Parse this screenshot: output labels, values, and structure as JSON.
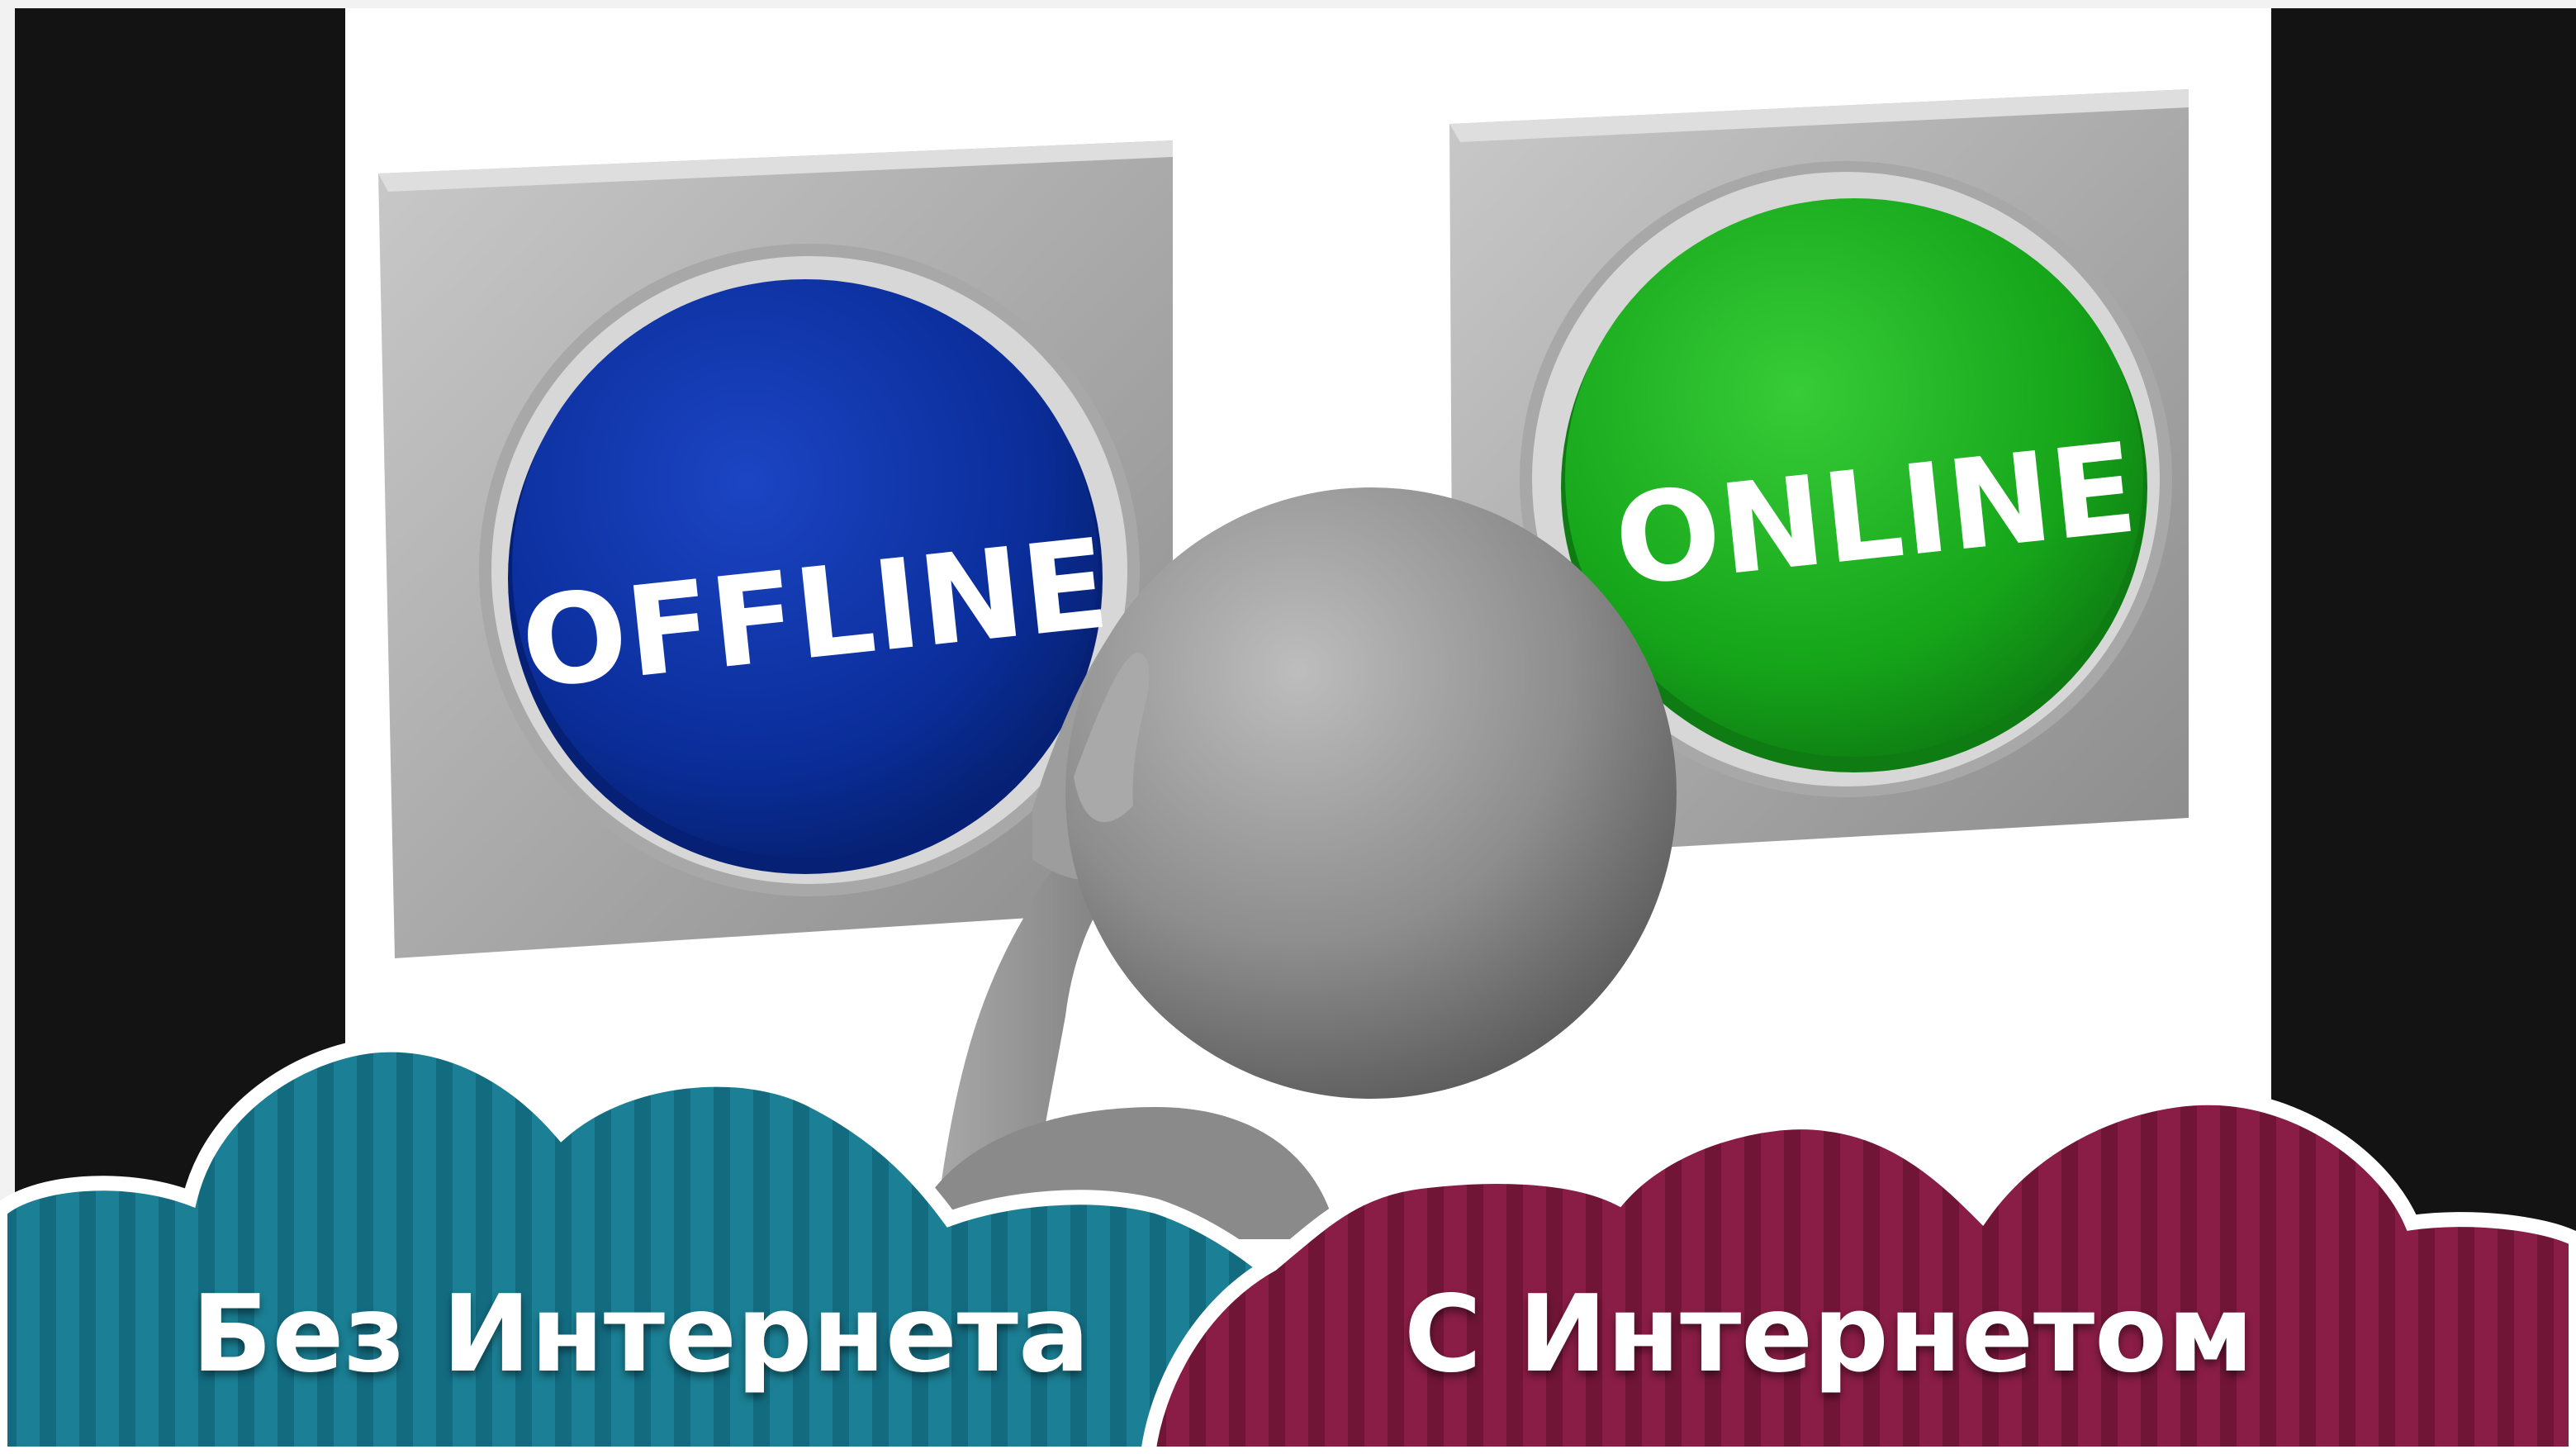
{
  "buttons": {
    "offline": {
      "label": "OFFLINE",
      "color": "#0a2d99"
    },
    "online": {
      "label": "ONLINE",
      "color": "#16a51a"
    }
  },
  "captions": {
    "left": {
      "text": "Без Интернета",
      "color": "#1b8095"
    },
    "right": {
      "text": "С Интернетом",
      "color": "#8a1d45"
    }
  },
  "colors": {
    "side_bars": "#131313",
    "background": "#ffffff",
    "figure": "#8d8d8d"
  }
}
